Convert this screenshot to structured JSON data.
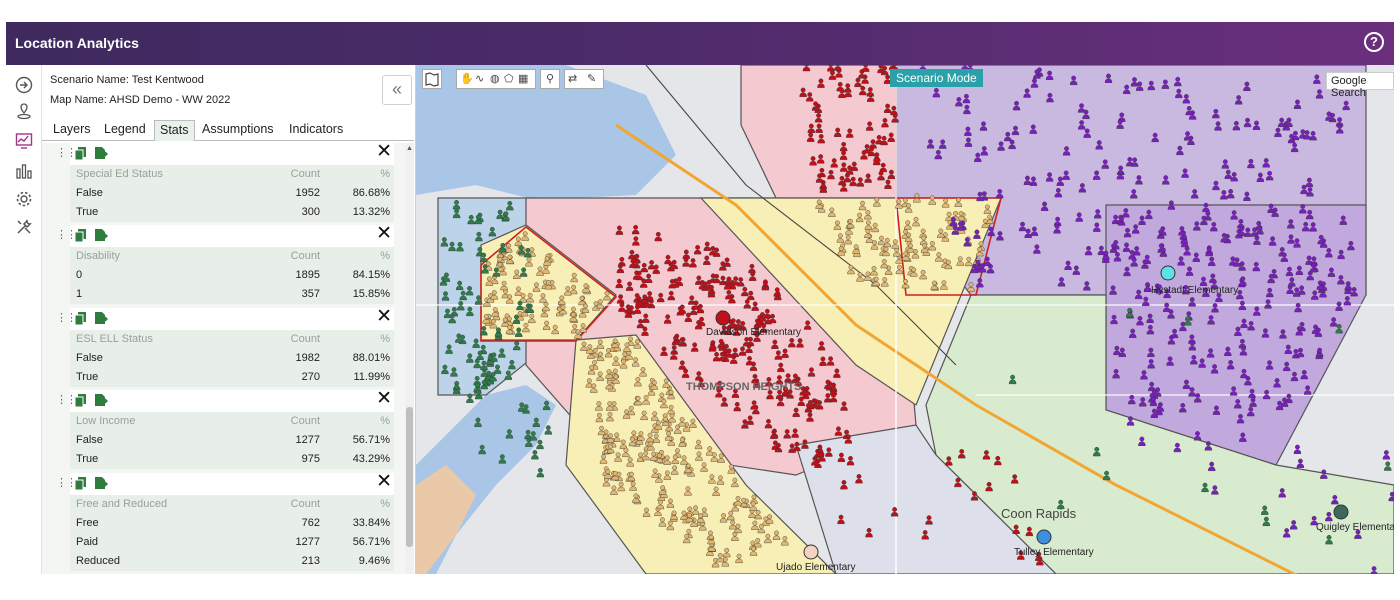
{
  "app": {
    "title": "Location Analytics",
    "help_glyph": "?"
  },
  "panel": {
    "scenario": "Scenario Name: Test Kentwood",
    "map_name": "Map Name: AHSD Demo - WW 2022",
    "collapse_glyph": "«",
    "tabs": [
      "Layers",
      "Legend",
      "Stats",
      "Assumptions",
      "Indicators"
    ],
    "active_tab": "Stats"
  },
  "stats": [
    {
      "title": "Special Ed Status",
      "count_label": "Count",
      "pct_label": "%",
      "rows": [
        {
          "label": "False",
          "count": "1952",
          "pct": "86.68%"
        },
        {
          "label": "True",
          "count": "300",
          "pct": "13.32%"
        }
      ]
    },
    {
      "title": "Disability",
      "count_label": "Count",
      "pct_label": "%",
      "rows": [
        {
          "label": "0",
          "count": "1895",
          "pct": "84.15%"
        },
        {
          "label": "1",
          "count": "357",
          "pct": "15.85%"
        }
      ]
    },
    {
      "title": "ESL ELL Status",
      "count_label": "Count",
      "pct_label": "%",
      "rows": [
        {
          "label": "False",
          "count": "1982",
          "pct": "88.01%"
        },
        {
          "label": "True",
          "count": "270",
          "pct": "11.99%"
        }
      ]
    },
    {
      "title": "Low Income",
      "count_label": "Count",
      "pct_label": "%",
      "rows": [
        {
          "label": "False",
          "count": "1277",
          "pct": "56.71%"
        },
        {
          "label": "True",
          "count": "975",
          "pct": "43.29%"
        }
      ]
    },
    {
      "title": "Free and Reduced",
      "count_label": "Count",
      "pct_label": "%",
      "rows": [
        {
          "label": "Free",
          "count": "762",
          "pct": "33.84%"
        },
        {
          "label": "Paid",
          "count": "1277",
          "pct": "56.71%"
        },
        {
          "label": "Reduced",
          "count": "213",
          "pct": "9.46%"
        }
      ]
    }
  ],
  "map": {
    "scenario_badge": "Scenario Mode",
    "google_search": "Google Search",
    "schools": [
      "Davidson Elementary",
      "Hystadt Elementary",
      "Tulley Elementary",
      "Quigley Elementary",
      "Ujado Elementary"
    ],
    "places": [
      "Coon Rapids",
      "THOMPSON HEIGHTS"
    ]
  },
  "colors": {
    "header_start": "#3e2a5e",
    "header_end": "#6a2f7d",
    "pink_zone": "#f4c9cf",
    "yellow_zone": "#f7efb5",
    "purple_zone": "#c9b8df",
    "green_zone": "#d8ebcf",
    "blue_zone": "#bcd3ea",
    "red_students": "#c0101a",
    "tan_students": "#e0b671",
    "purple_students": "#7a1fbf",
    "green_students": "#2f7d4a",
    "boundary_red": "#d02020"
  }
}
